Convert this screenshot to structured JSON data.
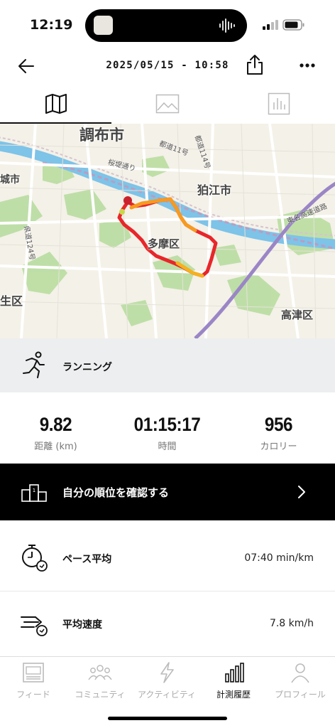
{
  "status_bar": {
    "time": "12:19"
  },
  "header": {
    "title": "2025/05/15 - 10:58"
  },
  "tabs": [
    {
      "icon": "map-icon",
      "active": true
    },
    {
      "icon": "image-icon",
      "active": false
    },
    {
      "icon": "chart-icon",
      "active": false
    }
  ],
  "map": {
    "labels": {
      "chofu": "調布市",
      "komae": "狛江市",
      "tama": "多摩区",
      "takatsu": "高津区",
      "seiku": "生区",
      "shi_left": "城市",
      "sakurazutsumi": "桜堤通り",
      "route11": "都道11号",
      "route114": "都道114号",
      "route124": "県道124号",
      "tomei": "東名高速道路"
    }
  },
  "activity": {
    "type_label": "ランニング",
    "icon": "runner-icon"
  },
  "stats": {
    "distance": {
      "value": "9.82",
      "label": "距離 (km)"
    },
    "time": {
      "value": "01:15:17",
      "label": "時間"
    },
    "calories": {
      "value": "956",
      "label": "カロリー"
    }
  },
  "ranking": {
    "label": "自分の順位を確認する"
  },
  "metrics": [
    {
      "label": "ペース平均",
      "value": "07:40 min/km",
      "icon": "stopwatch-icon"
    },
    {
      "label": "平均速度",
      "value": "7.8 km/h",
      "icon": "speed-icon"
    }
  ],
  "bottom_nav": [
    {
      "label": "フィード",
      "icon": "feed-icon",
      "active": false
    },
    {
      "label": "コミュニティ",
      "icon": "community-icon",
      "active": false
    },
    {
      "label": "アクティビティ",
      "icon": "lightning-icon",
      "active": false
    },
    {
      "label": "計測履歴",
      "icon": "history-icon",
      "active": true
    },
    {
      "label": "プロフィール",
      "icon": "profile-icon",
      "active": false
    }
  ],
  "colors": {
    "accent_dark": "#000000",
    "route_red": "#e8262a",
    "route_orange": "#f79a1e",
    "map_water": "#7ec3e8",
    "map_park": "#b4dc9a"
  }
}
